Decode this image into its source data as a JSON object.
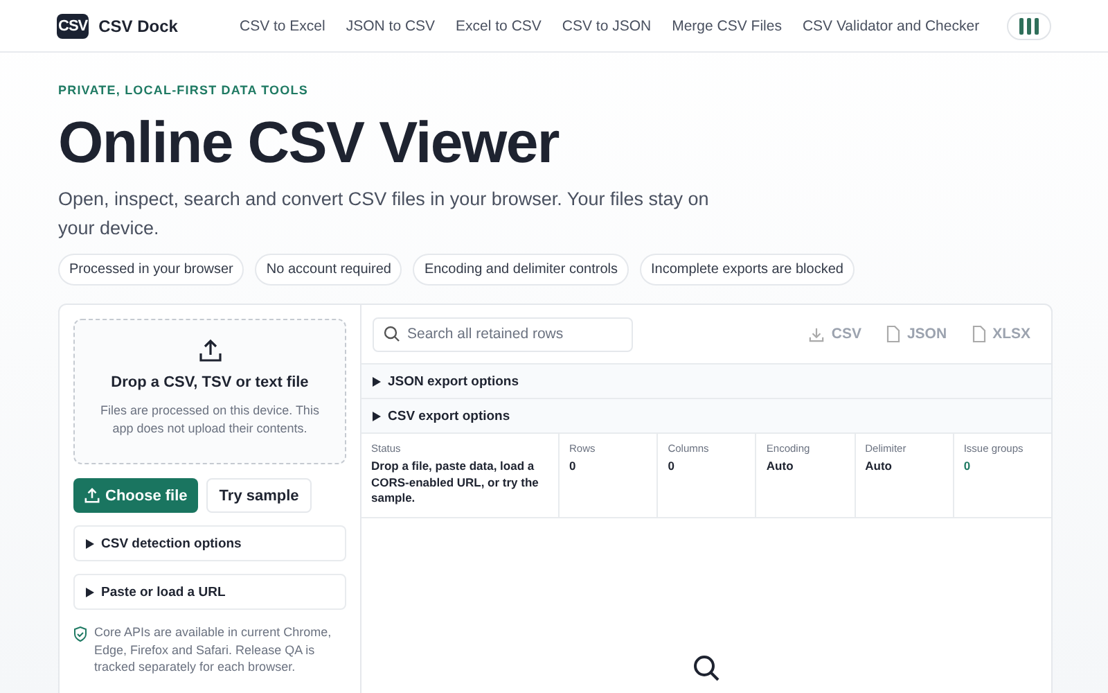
{
  "brand": {
    "logo": "CSV",
    "name": "CSV Dock"
  },
  "nav": [
    "CSV to Excel",
    "JSON to CSV",
    "Excel to CSV",
    "CSV to JSON",
    "Merge CSV Files",
    "CSV Validator and Checker"
  ],
  "eyebrow": "PRIVATE, LOCAL-FIRST DATA TOOLS",
  "title": "Online CSV Viewer",
  "subtitle": "Open, inspect, search and convert CSV files in your browser. Your files stay on your device.",
  "chips": [
    "Processed in your browser",
    "No account required",
    "Encoding and delimiter controls",
    "Incomplete exports are blocked"
  ],
  "dropzone": {
    "title": "Drop a CSV, TSV or text file",
    "note": "Files are processed on this device. This app does not upload their contents."
  },
  "buttons": [
    {
      "label": "Choose file",
      "kind": "primary"
    },
    {
      "label": "Try sample",
      "kind": "secondary"
    }
  ],
  "left_sections": [
    "CSV detection options",
    "Paste or load a URL"
  ],
  "compat_note": "Core APIs are available in current Chrome, Edge, Firefox and Safari. Release QA is tracked separately for each browser.",
  "search": {
    "placeholder": "Search all retained rows"
  },
  "exports": [
    {
      "label": "CSV",
      "kind": "download"
    },
    {
      "label": "JSON",
      "kind": "file"
    },
    {
      "label": "XLSX",
      "kind": "file"
    }
  ],
  "right_sections": [
    "JSON export options",
    "CSV export options"
  ],
  "stats": [
    {
      "label": "Status",
      "value": "Drop a file, paste data, load a CORS-enabled URL, or try the sample.",
      "accent": false
    },
    {
      "label": "Rows",
      "value": "0",
      "accent": false
    },
    {
      "label": "Columns",
      "value": "0",
      "accent": false
    },
    {
      "label": "Encoding",
      "value": "Auto",
      "accent": false
    },
    {
      "label": "Delimiter",
      "value": "Auto",
      "accent": false
    },
    {
      "label": "Issue groups",
      "value": "0",
      "accent": true
    }
  ]
}
